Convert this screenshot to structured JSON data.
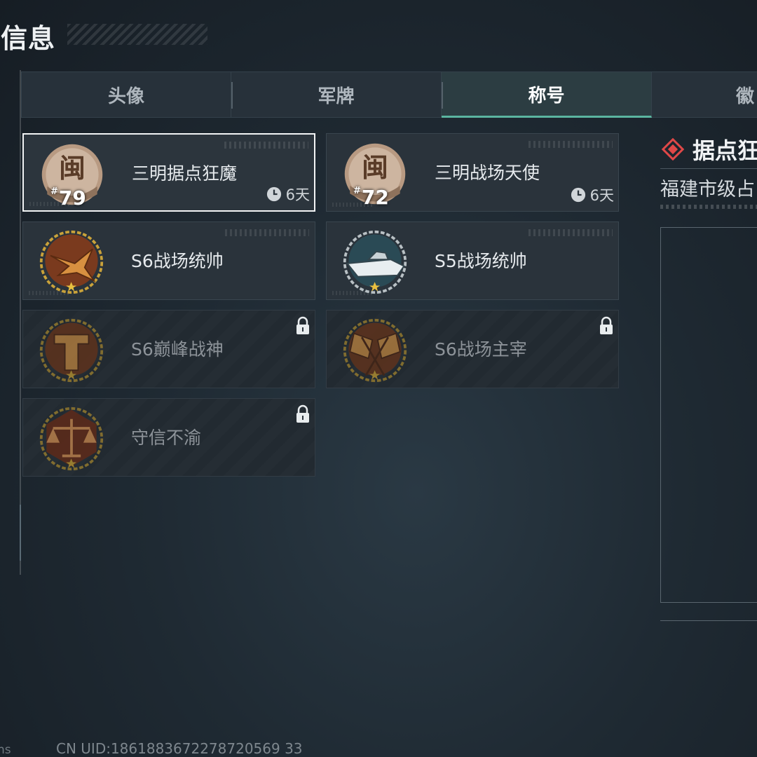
{
  "page": {
    "title": "色信息",
    "uid": "CN UID:1861883672278720569 33",
    "corner_text": "ns"
  },
  "tabs": [
    {
      "label": "头像",
      "active": false
    },
    {
      "label": "军牌",
      "active": false
    },
    {
      "label": "称号",
      "active": true
    },
    {
      "label": "徽",
      "active": false
    }
  ],
  "titles": [
    {
      "name": "三明据点狂魔",
      "rank": "79",
      "rank_prefix": "#",
      "timer": "6天",
      "selected": true,
      "locked": false,
      "emblem": "min-seal-emblem"
    },
    {
      "name": "三明战场天使",
      "rank": "72",
      "rank_prefix": "#",
      "timer": "6天",
      "selected": false,
      "locked": false,
      "emblem": "min-seal-emblem"
    },
    {
      "name": "S6战场统帅",
      "selected": false,
      "locked": false,
      "emblem": "fighter-jet-emblem"
    },
    {
      "name": "S5战场统帅",
      "selected": false,
      "locked": false,
      "emblem": "speedboat-emblem"
    },
    {
      "name": "S6巅峰战神",
      "selected": false,
      "locked": true,
      "emblem": "t-shield-emblem"
    },
    {
      "name": "S6战场主宰",
      "selected": false,
      "locked": true,
      "emblem": "crossed-flags-emblem"
    },
    {
      "name": "守信不渝",
      "selected": false,
      "locked": true,
      "emblem": "scales-emblem"
    }
  ],
  "detail": {
    "title": "据点狂",
    "subtitle": "福建市级占"
  },
  "colors": {
    "accent": "#5bb5a0",
    "diamond": "#e04848",
    "bronze": "#9a5a36",
    "seal": "#b89a82"
  }
}
